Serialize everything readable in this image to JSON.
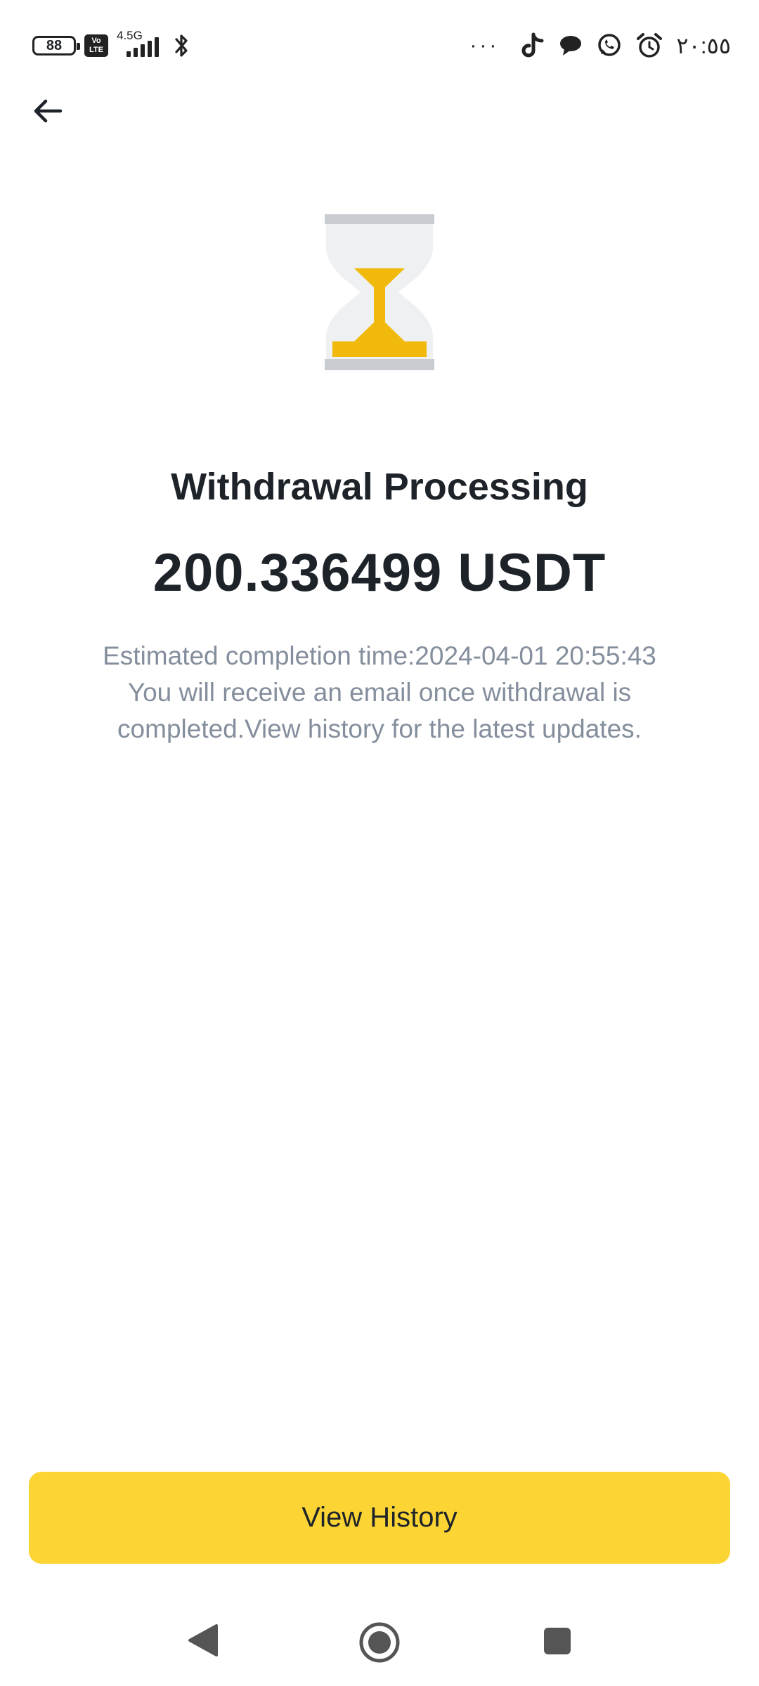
{
  "status_bar": {
    "battery_level": "88",
    "volte_label_top": "Vo",
    "volte_label_bottom": "LTE",
    "network_type": "4.5G",
    "more_indicator": "···",
    "time": "٢٠:٥٥",
    "icons": [
      "battery-icon",
      "volte-icon",
      "signal-icon",
      "bluetooth-icon",
      "tiktok-icon",
      "chat-bubble-icon",
      "whatsapp-icon",
      "alarm-icon"
    ]
  },
  "header": {
    "back_icon": "arrow-left-icon"
  },
  "status": {
    "icon": "hourglass-icon",
    "accent_color": "#f0b90b",
    "title": "Withdrawal Processing",
    "amount": "200.336499 USDT",
    "estimated_line": "Estimated completion time:2024-04-01 20:55:43",
    "message": "You will receive an email once withdrawal is completed.View history for the latest updates."
  },
  "actions": {
    "view_history_label": "View History",
    "button_color": "#fcd535"
  },
  "nav_bar": {
    "icons": [
      "nav-back-icon",
      "nav-home-icon",
      "nav-recents-icon"
    ]
  }
}
